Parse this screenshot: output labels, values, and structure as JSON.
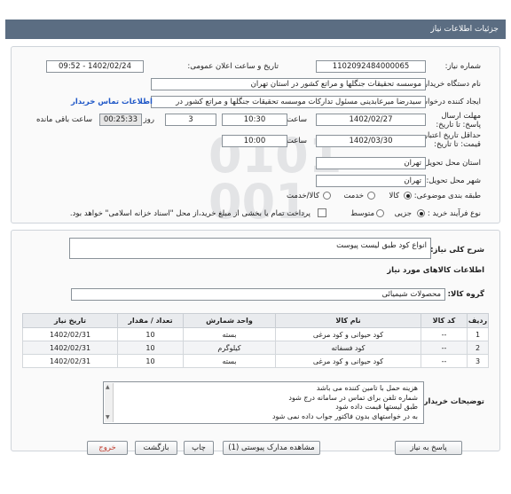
{
  "title": "جزئیات اطلاعات نیاز",
  "need_number": {
    "label": "شماره نیاز:",
    "value": "1102092484000065"
  },
  "announce": {
    "label": "تاریخ و ساعت اعلان عمومی:",
    "value": "1402/02/24 - 09:52"
  },
  "buyer_org": {
    "label": "نام دستگاه خریدار:",
    "value": "موسسه تحقیقات جنگلها و مراتع کشور در استان تهران"
  },
  "requester": {
    "label": "ایجاد کننده درخواست:",
    "value": "سیدرضا میرعابدینی مسئول تدارکات موسسه تحقیقات جنگلها و مراتع کشور در",
    "contact_link": "اطلاعات تماس خریدار"
  },
  "send_deadline": {
    "label": "مهلت ارسال پاسخ: تا تاریخ:",
    "date": "1402/02/27",
    "time_label": "ساعت",
    "time": "10:30",
    "days": "3",
    "days_label": "روز و",
    "remaining": "00:25:33",
    "remaining_label": "ساعت باقی مانده"
  },
  "price_validity": {
    "label": "حداقل تاریخ اعتبار قیمت: تا تاریخ:",
    "date": "1402/03/30",
    "time_label": "ساعت",
    "time": "10:00"
  },
  "province": {
    "label": "استان محل تحویل:",
    "value": "تهران"
  },
  "city": {
    "label": "شهر محل تحویل:",
    "value": "تهران"
  },
  "category": {
    "label": "طبقه بندی موضوعی:",
    "options": [
      "کالا",
      "خدمت",
      "کالا/خدمت"
    ],
    "selected": "کالا"
  },
  "purchase_type": {
    "label": "نوع فرآیند خرید :",
    "options": [
      "جزیی",
      "متوسط"
    ],
    "selected": "جزیی",
    "payment_note": "پرداخت تمام یا بخشی از مبلغ خرید،از محل \"اسناد خزانه اسلامی\" خواهد بود."
  },
  "general_desc": {
    "label": "شرح کلی نیاز:",
    "value": "انواع کود طبق لیست پیوست"
  },
  "items_header": "اطلاعات کالاهای مورد نیاز",
  "goods_group": {
    "label": "گروه کالا:",
    "value": "محصولات شیمیائی"
  },
  "table": {
    "headers": [
      "ردیف",
      "کد کالا",
      "نام کالا",
      "واحد شمارش",
      "تعداد / مقدار",
      "تاریخ نیاز"
    ],
    "rows": [
      [
        "1",
        "--",
        "کود حیوانی و کود مرغی",
        "بسته",
        "10",
        "1402/02/31"
      ],
      [
        "2",
        "--",
        "کود فسفاته",
        "کیلوگرم",
        "10",
        "1402/02/31"
      ],
      [
        "3",
        "--",
        "کود حیوانی و کود مرغی",
        "بسته",
        "10",
        "1402/02/31"
      ]
    ]
  },
  "buyer_notes": {
    "label": "توضیحات خریدار:",
    "lines": [
      "هزینه حمل با تامین کننده می باشد",
      "شماره تلفن برای تماس در سامانه درج شود",
      "طبق لیستها قیمت داده شود",
      "به در خواستهای بدون فاکتور جواب داده نمی شود"
    ]
  },
  "buttons": {
    "reply": "پاسخ به نیاز",
    "attachments": "مشاهده مدارک پیوستی (1)",
    "print": "چاپ",
    "back": "بازگشت",
    "exit": "خروج"
  }
}
